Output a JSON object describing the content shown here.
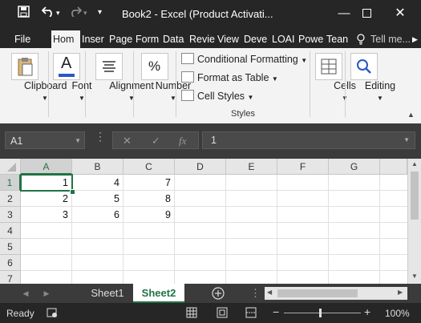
{
  "title_bar": {
    "title": "Book2 - Excel (Product Activati...",
    "save_icon": "save-icon",
    "undo_icon": "undo-icon",
    "redo_icon": "redo-icon",
    "customize_icon": "caret-down-icon"
  },
  "tabs": {
    "file": "File",
    "home": "Hom",
    "insert": "Inser",
    "page": "Page",
    "formulas": "Form",
    "data": "Data",
    "review": "Revie",
    "view": "View",
    "developer": "Deve",
    "load": "LOAI",
    "power": "Powe",
    "team": "Tean",
    "tell_me": "Tell me..."
  },
  "ribbon": {
    "clipboard": "Clipboard",
    "font": "Font",
    "alignment": "Alignment",
    "number": "Number",
    "conditional_formatting": "Conditional Formatting",
    "format_as_table": "Format as Table",
    "cell_styles": "Cell Styles",
    "styles_group": "Styles",
    "cells": "Cells",
    "editing": "Editing",
    "number_icon_glyph": "%",
    "font_icon_glyph": "A"
  },
  "formula_bar": {
    "name_box": "A1",
    "fx_label": "fx",
    "content": "1"
  },
  "sheet": {
    "columns": [
      "A",
      "B",
      "C",
      "D",
      "E",
      "F",
      "G"
    ],
    "rows": [
      "1",
      "2",
      "3",
      "4",
      "5",
      "6",
      "7"
    ],
    "cells": [
      [
        "1",
        "4",
        "7"
      ],
      [
        "2",
        "5",
        "8"
      ],
      [
        "3",
        "6",
        "9"
      ]
    ]
  },
  "sheet_tabs": {
    "sheet1": "Sheet1",
    "sheet2": "Sheet2",
    "active": "Sheet2"
  },
  "status_bar": {
    "ready": "Ready",
    "zoom": "100%",
    "zoom_minus": "−",
    "zoom_plus": "+"
  },
  "colors": {
    "title_bg": "#262626",
    "ribbon_bg": "#f3f3f3",
    "active_tab_text": "#217346",
    "selection": "#217346"
  }
}
